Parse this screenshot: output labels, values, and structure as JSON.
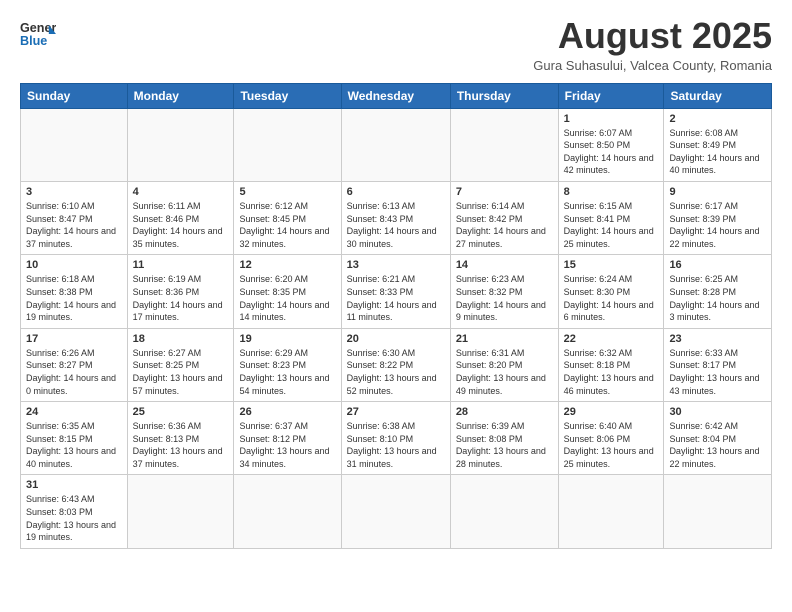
{
  "header": {
    "logo_general": "General",
    "logo_blue": "Blue",
    "month_title": "August 2025",
    "subtitle": "Gura Suhasului, Valcea County, Romania"
  },
  "weekdays": [
    "Sunday",
    "Monday",
    "Tuesday",
    "Wednesday",
    "Thursday",
    "Friday",
    "Saturday"
  ],
  "weeks": [
    [
      {
        "day": "",
        "info": ""
      },
      {
        "day": "",
        "info": ""
      },
      {
        "day": "",
        "info": ""
      },
      {
        "day": "",
        "info": ""
      },
      {
        "day": "",
        "info": ""
      },
      {
        "day": "1",
        "info": "Sunrise: 6:07 AM\nSunset: 8:50 PM\nDaylight: 14 hours and 42 minutes."
      },
      {
        "day": "2",
        "info": "Sunrise: 6:08 AM\nSunset: 8:49 PM\nDaylight: 14 hours and 40 minutes."
      }
    ],
    [
      {
        "day": "3",
        "info": "Sunrise: 6:10 AM\nSunset: 8:47 PM\nDaylight: 14 hours and 37 minutes."
      },
      {
        "day": "4",
        "info": "Sunrise: 6:11 AM\nSunset: 8:46 PM\nDaylight: 14 hours and 35 minutes."
      },
      {
        "day": "5",
        "info": "Sunrise: 6:12 AM\nSunset: 8:45 PM\nDaylight: 14 hours and 32 minutes."
      },
      {
        "day": "6",
        "info": "Sunrise: 6:13 AM\nSunset: 8:43 PM\nDaylight: 14 hours and 30 minutes."
      },
      {
        "day": "7",
        "info": "Sunrise: 6:14 AM\nSunset: 8:42 PM\nDaylight: 14 hours and 27 minutes."
      },
      {
        "day": "8",
        "info": "Sunrise: 6:15 AM\nSunset: 8:41 PM\nDaylight: 14 hours and 25 minutes."
      },
      {
        "day": "9",
        "info": "Sunrise: 6:17 AM\nSunset: 8:39 PM\nDaylight: 14 hours and 22 minutes."
      }
    ],
    [
      {
        "day": "10",
        "info": "Sunrise: 6:18 AM\nSunset: 8:38 PM\nDaylight: 14 hours and 19 minutes."
      },
      {
        "day": "11",
        "info": "Sunrise: 6:19 AM\nSunset: 8:36 PM\nDaylight: 14 hours and 17 minutes."
      },
      {
        "day": "12",
        "info": "Sunrise: 6:20 AM\nSunset: 8:35 PM\nDaylight: 14 hours and 14 minutes."
      },
      {
        "day": "13",
        "info": "Sunrise: 6:21 AM\nSunset: 8:33 PM\nDaylight: 14 hours and 11 minutes."
      },
      {
        "day": "14",
        "info": "Sunrise: 6:23 AM\nSunset: 8:32 PM\nDaylight: 14 hours and 9 minutes."
      },
      {
        "day": "15",
        "info": "Sunrise: 6:24 AM\nSunset: 8:30 PM\nDaylight: 14 hours and 6 minutes."
      },
      {
        "day": "16",
        "info": "Sunrise: 6:25 AM\nSunset: 8:28 PM\nDaylight: 14 hours and 3 minutes."
      }
    ],
    [
      {
        "day": "17",
        "info": "Sunrise: 6:26 AM\nSunset: 8:27 PM\nDaylight: 14 hours and 0 minutes."
      },
      {
        "day": "18",
        "info": "Sunrise: 6:27 AM\nSunset: 8:25 PM\nDaylight: 13 hours and 57 minutes."
      },
      {
        "day": "19",
        "info": "Sunrise: 6:29 AM\nSunset: 8:23 PM\nDaylight: 13 hours and 54 minutes."
      },
      {
        "day": "20",
        "info": "Sunrise: 6:30 AM\nSunset: 8:22 PM\nDaylight: 13 hours and 52 minutes."
      },
      {
        "day": "21",
        "info": "Sunrise: 6:31 AM\nSunset: 8:20 PM\nDaylight: 13 hours and 49 minutes."
      },
      {
        "day": "22",
        "info": "Sunrise: 6:32 AM\nSunset: 8:18 PM\nDaylight: 13 hours and 46 minutes."
      },
      {
        "day": "23",
        "info": "Sunrise: 6:33 AM\nSunset: 8:17 PM\nDaylight: 13 hours and 43 minutes."
      }
    ],
    [
      {
        "day": "24",
        "info": "Sunrise: 6:35 AM\nSunset: 8:15 PM\nDaylight: 13 hours and 40 minutes."
      },
      {
        "day": "25",
        "info": "Sunrise: 6:36 AM\nSunset: 8:13 PM\nDaylight: 13 hours and 37 minutes."
      },
      {
        "day": "26",
        "info": "Sunrise: 6:37 AM\nSunset: 8:12 PM\nDaylight: 13 hours and 34 minutes."
      },
      {
        "day": "27",
        "info": "Sunrise: 6:38 AM\nSunset: 8:10 PM\nDaylight: 13 hours and 31 minutes."
      },
      {
        "day": "28",
        "info": "Sunrise: 6:39 AM\nSunset: 8:08 PM\nDaylight: 13 hours and 28 minutes."
      },
      {
        "day": "29",
        "info": "Sunrise: 6:40 AM\nSunset: 8:06 PM\nDaylight: 13 hours and 25 minutes."
      },
      {
        "day": "30",
        "info": "Sunrise: 6:42 AM\nSunset: 8:04 PM\nDaylight: 13 hours and 22 minutes."
      }
    ],
    [
      {
        "day": "31",
        "info": "Sunrise: 6:43 AM\nSunset: 8:03 PM\nDaylight: 13 hours and 19 minutes."
      },
      {
        "day": "",
        "info": ""
      },
      {
        "day": "",
        "info": ""
      },
      {
        "day": "",
        "info": ""
      },
      {
        "day": "",
        "info": ""
      },
      {
        "day": "",
        "info": ""
      },
      {
        "day": "",
        "info": ""
      }
    ]
  ]
}
